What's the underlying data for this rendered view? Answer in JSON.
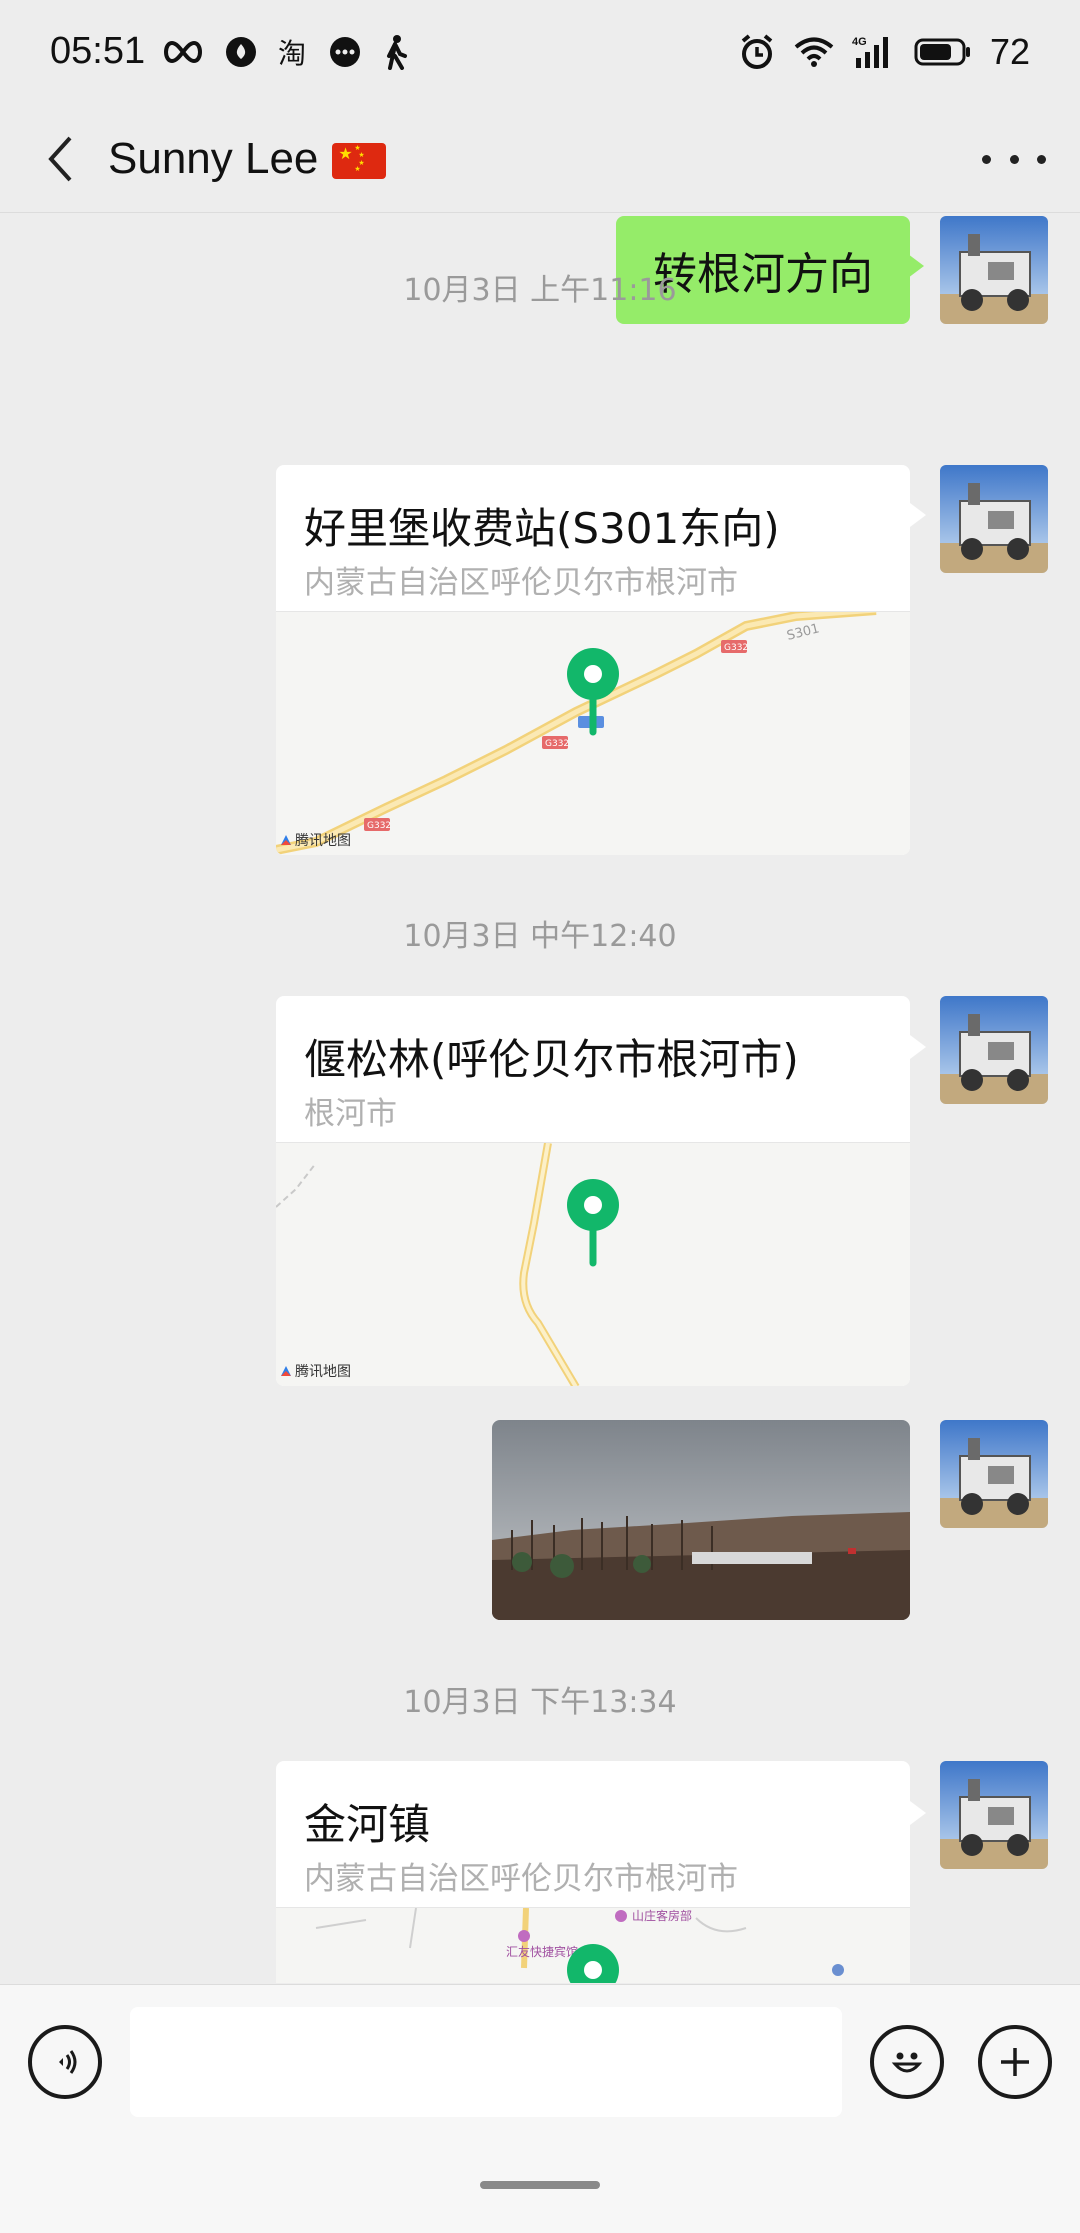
{
  "status": {
    "time": "05:51",
    "battery": "72",
    "left_icons": [
      "infinity-icon",
      "app-drop-icon",
      "taobao-icon",
      "chat-bubble-icon",
      "walking-icon"
    ],
    "right_icons": [
      "alarm-icon",
      "wifi-icon",
      "signal-4g-icon",
      "battery-icon"
    ],
    "network_label": "4G"
  },
  "header": {
    "title": "Sunny Lee",
    "flag": "china-flag-icon"
  },
  "messages": [
    {
      "type": "text",
      "text": "转根河方向",
      "from": "me"
    },
    {
      "type": "timestamp",
      "text": "10月3日 上午11:16"
    },
    {
      "type": "location",
      "title": "好里堡收费站(S301东向)",
      "address": "内蒙古自治区呼伦贝尔市根河市",
      "map_brand": "腾讯地图",
      "road_labels": [
        "G332",
        "G332",
        "G332",
        "S301"
      ]
    },
    {
      "type": "timestamp",
      "text": "10月3日 中午12:40"
    },
    {
      "type": "location",
      "title": "偃松林(呼伦贝尔市根河市)",
      "address": "根河市",
      "map_brand": "腾讯地图"
    },
    {
      "type": "image",
      "description_icon": "landscape-photo"
    },
    {
      "type": "timestamp",
      "text": "10月3日 下午13:34"
    },
    {
      "type": "location",
      "title": "金河镇",
      "address": "内蒙古自治区呼伦贝尔市根河市",
      "poi_labels": [
        "山庄客房部",
        "汇友快捷宾馆"
      ]
    }
  ],
  "input": {
    "value": "",
    "placeholder": ""
  },
  "colors": {
    "background": "#ededed",
    "bubble_me": "#95ec69",
    "pin": "#12b76a"
  }
}
